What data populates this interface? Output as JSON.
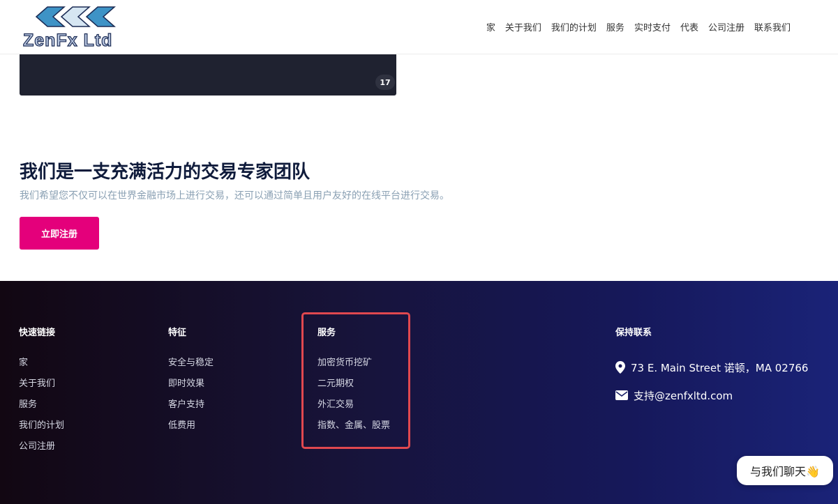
{
  "logo": {
    "text": "ZenFx Ltd"
  },
  "nav": [
    {
      "label": "家"
    },
    {
      "label": "关于我们"
    },
    {
      "label": "我们的计划"
    },
    {
      "label": "服务"
    },
    {
      "label": "实时支付"
    },
    {
      "label": "代表"
    },
    {
      "label": "公司注册"
    },
    {
      "label": "联系我们"
    }
  ],
  "widget": {
    "badge": "17"
  },
  "hero": {
    "title": "我们是一支充满活力的交易专家团队",
    "subtitle": "我们希望您不仅可以在世界金融市场上进行交易，还可以通过简单且用户友好的在线平台进行交易。",
    "cta_label": "立即注册"
  },
  "footer": {
    "quick_links": {
      "title": "快速链接",
      "items": [
        "家",
        "关于我们",
        "服务",
        "我们的计划",
        "公司注册"
      ]
    },
    "features": {
      "title": "特征",
      "items": [
        "安全与稳定",
        "即时效果",
        "客户支持",
        "低费用"
      ]
    },
    "services": {
      "title": "服务",
      "items": [
        "加密货币挖矿",
        "二元期权",
        "外汇交易",
        "指数、金属、股票"
      ]
    },
    "contact": {
      "title": "保持联系",
      "address": "73 E. Main Street 诺顿，MA 02766",
      "email": "支持@zenfxltd.com"
    }
  },
  "chat": {
    "label": "与我们聊天👋"
  },
  "colors": {
    "cta": "#e4007b",
    "highlight": "#e0484f",
    "title": "#0f1b3b"
  }
}
